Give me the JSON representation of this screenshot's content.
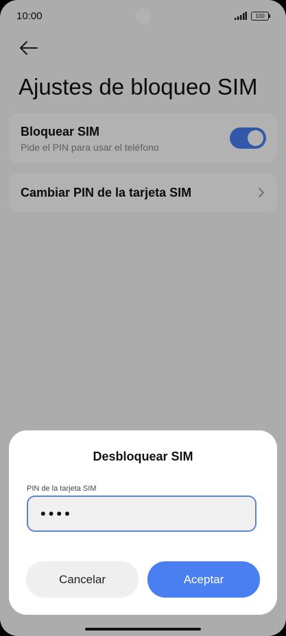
{
  "status_bar": {
    "time": "10:00",
    "battery": "100",
    "icons": [
      "signal-icon",
      "battery-icon"
    ]
  },
  "header": {
    "back_icon": "arrow-left-icon",
    "title": "Ajustes de bloqueo SIM"
  },
  "settings": {
    "lock_sim": {
      "title": "Bloquear SIM",
      "subtitle": "Pide el PIN para usar el teléfono",
      "enabled": true
    },
    "change_pin": {
      "title": "Cambiar PIN de la tarjeta SIM",
      "icon": "chevron-right-icon"
    }
  },
  "dialog": {
    "title": "Desbloquear SIM",
    "pin_label": "PIN de la tarjeta SIM",
    "pin_value": "••••",
    "cancel_label": "Cancelar",
    "accept_label": "Aceptar"
  },
  "colors": {
    "accent": "#4a7ff2",
    "toggle_on": "#4a7ff2",
    "input_border": "#5b84d8"
  }
}
